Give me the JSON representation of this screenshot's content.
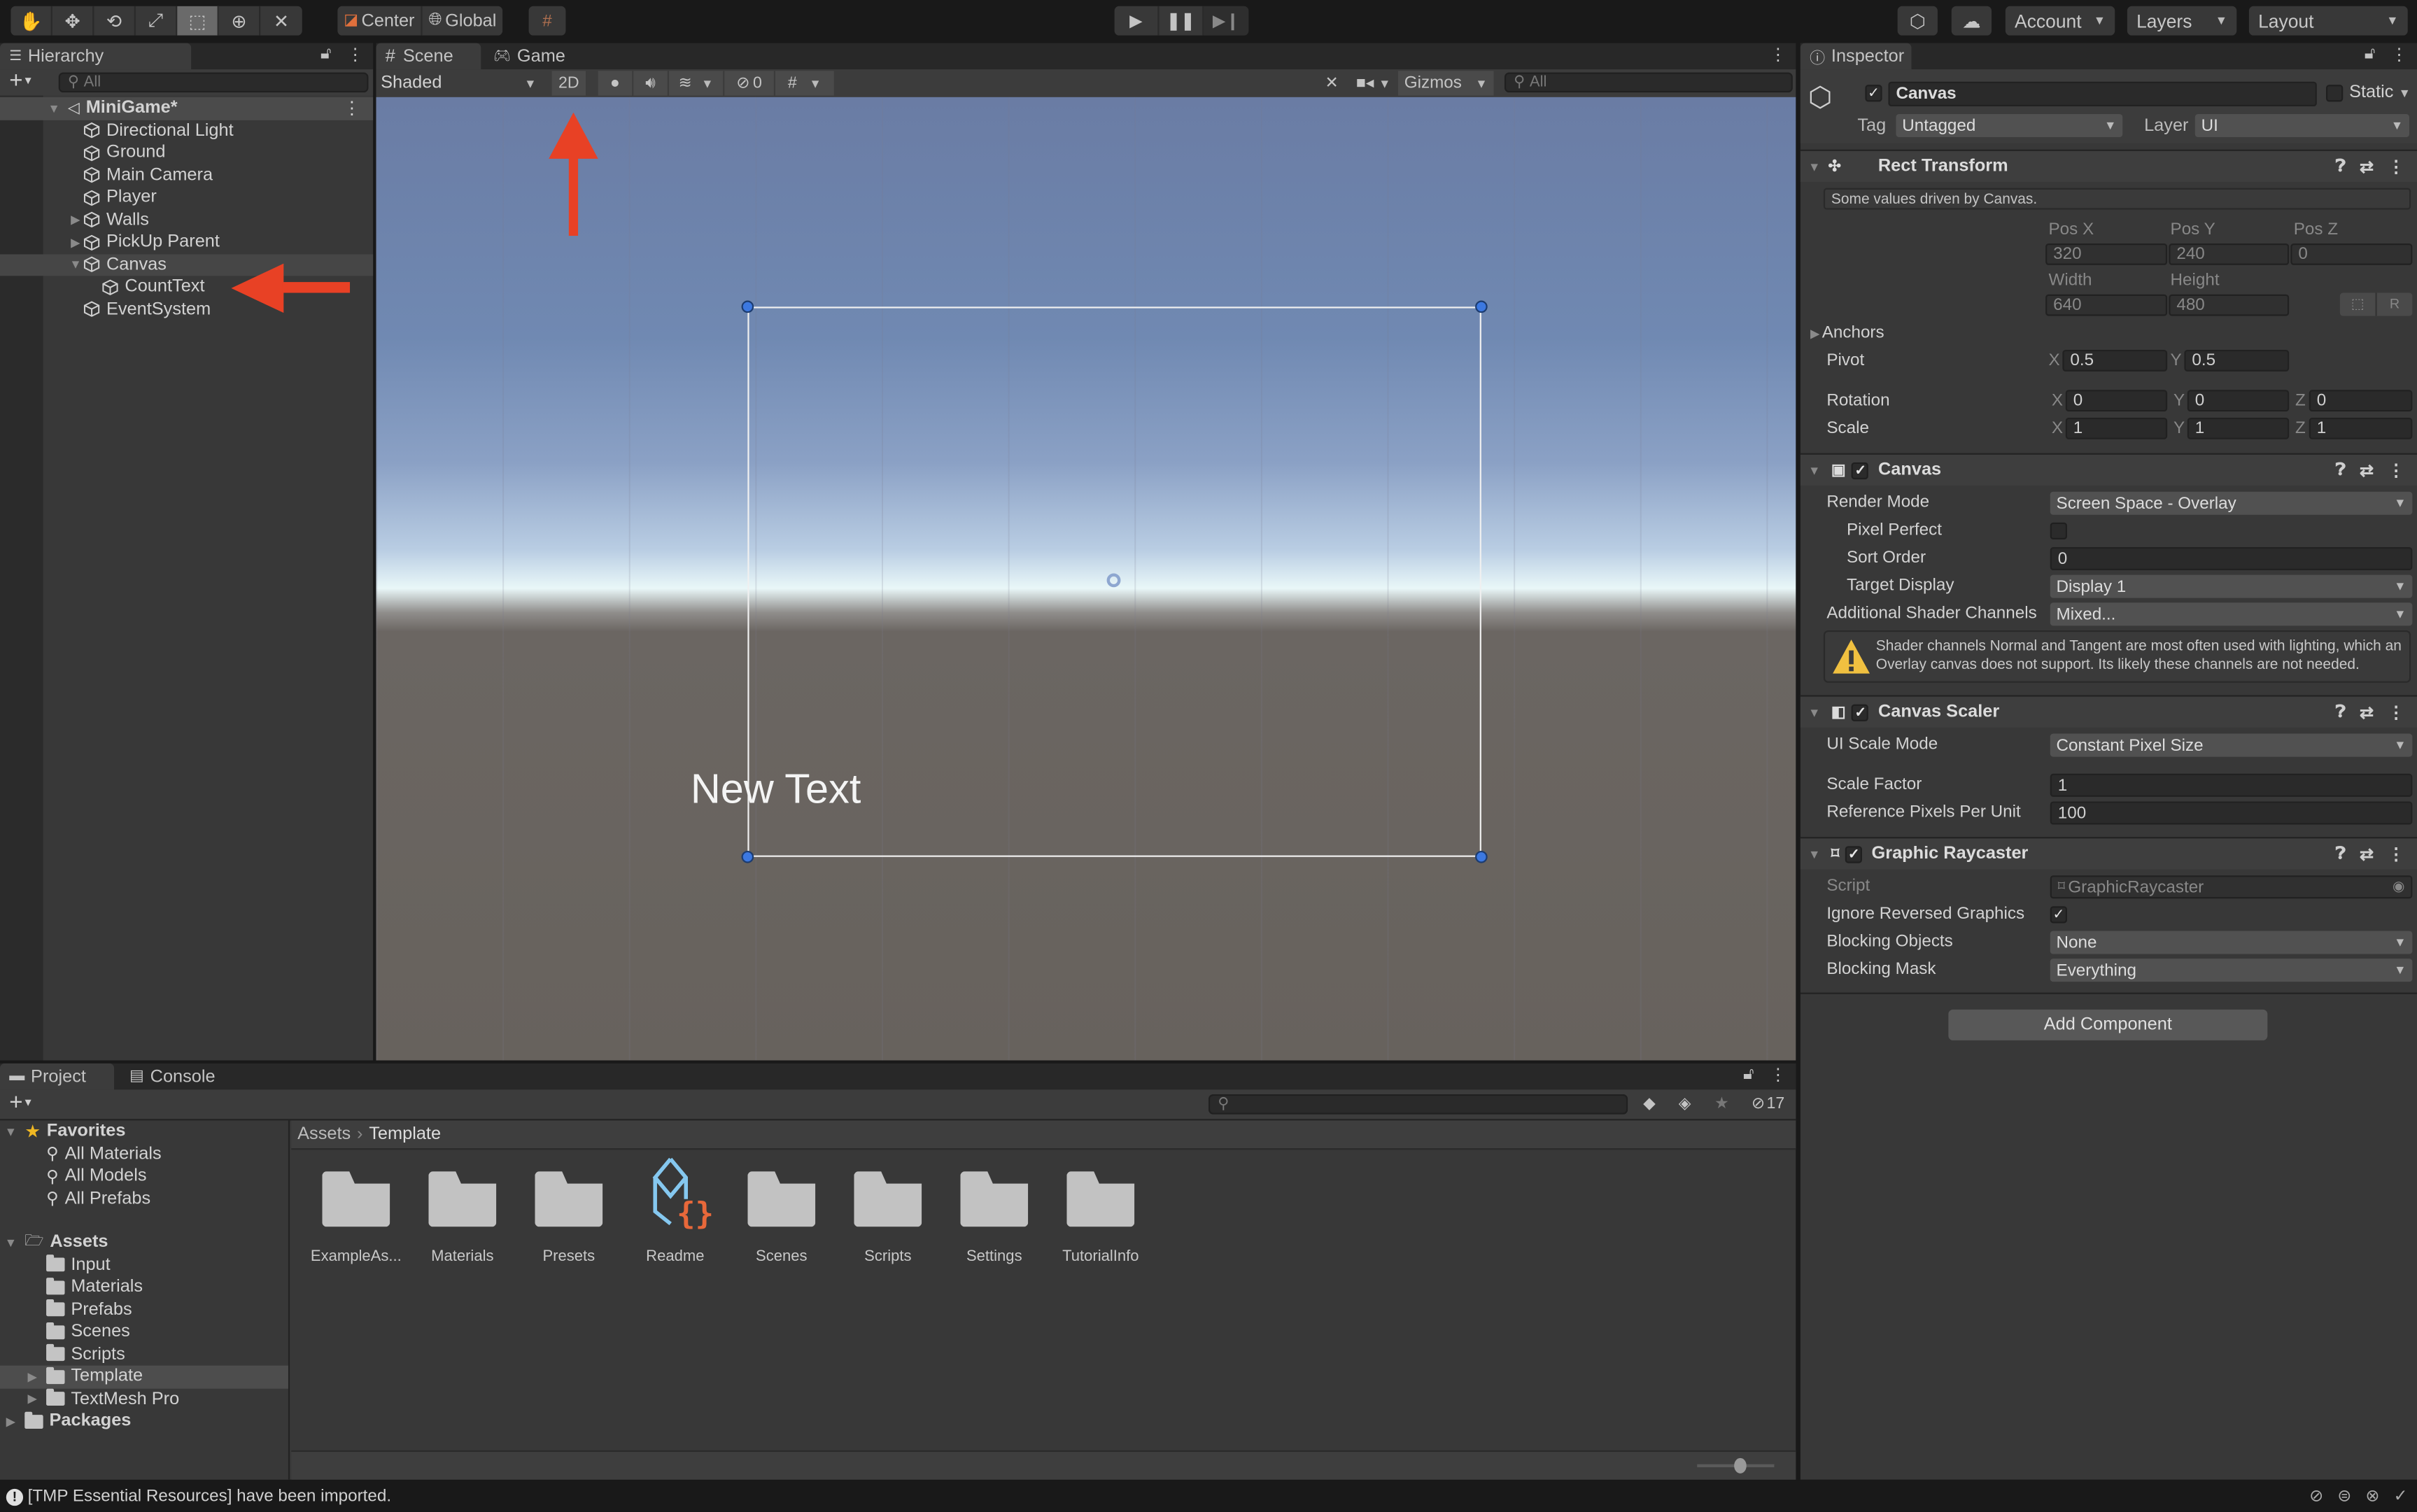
{
  "toolbar": {
    "tools": [
      "hand-tool",
      "move-tool",
      "rotate-tool",
      "scale-tool",
      "rect-tool",
      "transform-tool",
      "custom-tool"
    ],
    "active_tool": "rect-tool",
    "pivot_mode": "Center",
    "pivot_rotation": "Global",
    "account_label": "Account",
    "layers_label": "Layers",
    "layout_label": "Layout"
  },
  "hierarchy": {
    "tab_label": "Hierarchy",
    "search_placeholder": "All",
    "scene_name": "MiniGame*",
    "items": [
      {
        "label": "Directional Light",
        "depth": 1,
        "expandable": false
      },
      {
        "label": "Ground",
        "depth": 1,
        "expandable": false
      },
      {
        "label": "Main Camera",
        "depth": 1,
        "expandable": false
      },
      {
        "label": "Player",
        "depth": 1,
        "expandable": false
      },
      {
        "label": "Walls",
        "depth": 1,
        "expandable": true,
        "expanded": false
      },
      {
        "label": "PickUp Parent",
        "depth": 1,
        "expandable": true,
        "expanded": false
      },
      {
        "label": "Canvas",
        "depth": 1,
        "expandable": true,
        "expanded": true,
        "selected": true
      },
      {
        "label": "CountText",
        "depth": 2,
        "expandable": false
      },
      {
        "label": "EventSystem",
        "depth": 1,
        "expandable": false
      }
    ]
  },
  "scene": {
    "tabs": [
      "Scene",
      "Game"
    ],
    "active_tab": "Scene",
    "shading_mode": "Shaded",
    "mode_2d_label": "2D",
    "hidden_count": "0",
    "gizmos_label": "Gizmos",
    "search_placeholder": "All",
    "canvas_text": "New Text"
  },
  "annotations": {
    "arrow_color": "#e84125",
    "arrows": [
      "points-to-2D-button",
      "points-to-CountText"
    ]
  },
  "inspector": {
    "tab_label": "Inspector",
    "object_name": "Canvas",
    "active": true,
    "static_label": "Static",
    "tag_label": "Tag",
    "tag_value": "Untagged",
    "layer_label": "Layer",
    "layer_value": "UI",
    "rect_transform": {
      "title": "Rect Transform",
      "info": "Some values driven by Canvas.",
      "pos_x_label": "Pos X",
      "pos_x": "320",
      "pos_y_label": "Pos Y",
      "pos_y": "240",
      "pos_z_label": "Pos Z",
      "pos_z": "0",
      "width_label": "Width",
      "width": "640",
      "height_label": "Height",
      "height": "480",
      "raw_edit_label": "R",
      "anchors_label": "Anchors",
      "pivot_label": "Pivot",
      "pivot_x": "0.5",
      "pivot_y": "0.5",
      "rotation_label": "Rotation",
      "rot_x": "0",
      "rot_y": "0",
      "rot_z": "0",
      "scale_label": "Scale",
      "scale_x": "1",
      "scale_y": "1",
      "scale_z": "1",
      "axis_x": "X",
      "axis_y": "Y",
      "axis_z": "Z"
    },
    "canvas": {
      "title": "Canvas",
      "enabled": true,
      "render_mode_label": "Render Mode",
      "render_mode": "Screen Space - Overlay",
      "pixel_perfect_label": "Pixel Perfect",
      "pixel_perfect": false,
      "sort_order_label": "Sort Order",
      "sort_order": "0",
      "target_display_label": "Target Display",
      "target_display": "Display 1",
      "shader_channels_label": "Additional Shader Channels",
      "shader_channels": "Mixed...",
      "warning": "Shader channels Normal and Tangent are most often used with lighting, which an Overlay canvas does not support. Its likely these channels are not needed."
    },
    "canvas_scaler": {
      "title": "Canvas Scaler",
      "enabled": true,
      "ui_scale_mode_label": "UI Scale Mode",
      "ui_scale_mode": "Constant Pixel Size",
      "scale_factor_label": "Scale Factor",
      "scale_factor": "1",
      "ref_ppu_label": "Reference Pixels Per Unit",
      "ref_ppu": "100"
    },
    "graphic_raycaster": {
      "title": "Graphic Raycaster",
      "enabled": true,
      "script_label": "Script",
      "script": "GraphicRaycaster",
      "ignore_reversed_label": "Ignore Reversed Graphics",
      "ignore_reversed": true,
      "blocking_objects_label": "Blocking Objects",
      "blocking_objects": "None",
      "blocking_mask_label": "Blocking Mask",
      "blocking_mask": "Everything"
    },
    "add_component_label": "Add Component"
  },
  "project": {
    "tabs": [
      "Project",
      "Console"
    ],
    "active_tab": "Project",
    "hidden_packages_count": "17",
    "favorites_label": "Favorites",
    "favorites": [
      "All Materials",
      "All Models",
      "All Prefabs"
    ],
    "assets_label": "Assets",
    "asset_folders": [
      {
        "label": "Input",
        "expandable": false
      },
      {
        "label": "Materials",
        "expandable": false
      },
      {
        "label": "Prefabs",
        "expandable": false
      },
      {
        "label": "Scenes",
        "expandable": false
      },
      {
        "label": "Scripts",
        "expandable": false
      },
      {
        "label": "Template",
        "expandable": true,
        "selected": true
      },
      {
        "label": "TextMesh Pro",
        "expandable": true
      }
    ],
    "packages_label": "Packages",
    "breadcrumb": [
      "Assets",
      "Template"
    ],
    "grid_items": [
      {
        "label": "ExampleAs...",
        "type": "folder"
      },
      {
        "label": "Materials",
        "type": "folder"
      },
      {
        "label": "Presets",
        "type": "folder"
      },
      {
        "label": "Readme",
        "type": "readme-asset"
      },
      {
        "label": "Scenes",
        "type": "folder"
      },
      {
        "label": "Scripts",
        "type": "folder"
      },
      {
        "label": "Settings",
        "type": "folder"
      },
      {
        "label": "TutorialInfo",
        "type": "folder"
      }
    ],
    "icon_size_slider": 0.55
  },
  "status_bar": {
    "message": "[TMP Essential Resources] have been imported."
  }
}
